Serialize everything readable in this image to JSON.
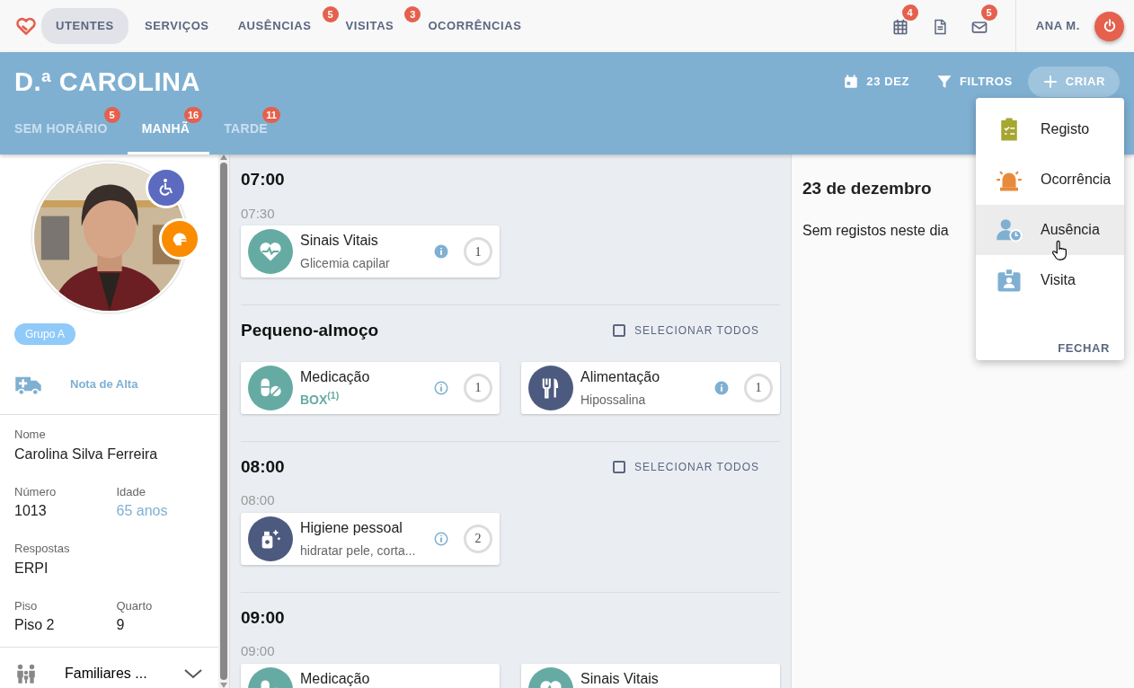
{
  "nav": {
    "items": [
      {
        "label": "UTENTES",
        "selected": true
      },
      {
        "label": "SERVIÇOS",
        "selected": false
      },
      {
        "label": "AUSÊNCIAS",
        "selected": false,
        "badge": "5"
      },
      {
        "label": "VISITAS",
        "selected": false,
        "badge": "3"
      },
      {
        "label": "OCORRÊNCIAS",
        "selected": false
      }
    ],
    "icons": [
      {
        "kind": "calendar",
        "badge": "4"
      },
      {
        "kind": "document"
      },
      {
        "kind": "mail",
        "badge": "5"
      }
    ],
    "user": "ANA M."
  },
  "header": {
    "title": "D.ª CAROLINA",
    "date": "23 DEZ",
    "filters": "FILTROS",
    "create": "CRIAR",
    "tabs": [
      {
        "label": "SEM HORÁRIO",
        "badge": "5",
        "selected": false
      },
      {
        "label": "MANHÃ",
        "badge": "16",
        "selected": true
      },
      {
        "label": "TARDE",
        "badge": "11",
        "selected": false
      }
    ]
  },
  "profile": {
    "photo": {
      "kind": "picture"
    },
    "group": "Grupo A",
    "discharge": "Nota de Alta",
    "fields": [
      [
        {
          "label": "Nome",
          "value": "Carolina Silva Ferreira",
          "highlight": false
        }
      ],
      [
        {
          "label": "Número",
          "value": "1013",
          "highlight": false
        },
        {
          "label": "Idade",
          "value": "65 anos",
          "highlight": true
        }
      ],
      [
        {
          "label": "Respostas",
          "value": "ERPI",
          "highlight": false
        }
      ],
      [
        {
          "label": "Piso",
          "value": "Piso 2",
          "highlight": false
        },
        {
          "label": "Quarto",
          "value": "9",
          "highlight": false
        }
      ]
    ],
    "family": "Familiares ..."
  },
  "schedule": [
    {
      "title": "07:00",
      "groups": [
        {
          "time": "07:30",
          "cards": [
            {
              "kind": "vitals",
              "title": "Sinais Vitais",
              "subtitle": "Glicemia capilar",
              "emphasis": false,
              "info_filled": true,
              "count": "1"
            }
          ]
        }
      ]
    },
    {
      "title": "Pequeno-almoço",
      "select_all": {
        "label": "SELECIONAR TODOS",
        "checked": false
      },
      "groups": [
        {
          "cards": [
            {
              "kind": "medication",
              "title": "Medicação",
              "subtitle": "BOX$^{(1)}$",
              "emphasis": true,
              "info_filled": false,
              "count": "1"
            },
            {
              "kind": "food",
              "title": "Alimentação",
              "subtitle": "Hipossalina",
              "emphasis": false,
              "info_filled": true,
              "count": "1"
            }
          ]
        }
      ]
    },
    {
      "title": "08:00",
      "select_all": {
        "label": "SELECIONAR TODOS",
        "checked": false
      },
      "groups": [
        {
          "time": "08:00",
          "cards": [
            {
              "kind": "hygiene",
              "title": "Higiene pessoal",
              "subtitle": "hidratar pele, corta...",
              "emphasis": false,
              "info_filled": false,
              "count": "2"
            }
          ]
        }
      ]
    },
    {
      "title": "09:00",
      "groups": [
        {
          "time": "09:00",
          "cards": [
            {
              "kind": "medication",
              "title": "Medicação"
            },
            {
              "kind": "vitals",
              "title": "Sinais Vitais"
            }
          ]
        }
      ]
    }
  ],
  "day": {
    "title": "23 de dezembro",
    "text": "Sem registos neste dia"
  },
  "menu": {
    "items": [
      {
        "kind": "registo",
        "label": "Registo",
        "selected": false
      },
      {
        "kind": "occurrence",
        "label": "Ocorrência",
        "selected": false
      },
      {
        "kind": "absence",
        "label": "Ausência",
        "selected": true
      },
      {
        "kind": "visit",
        "label": "Visita",
        "selected": false
      }
    ],
    "close": "FECHAR"
  }
}
